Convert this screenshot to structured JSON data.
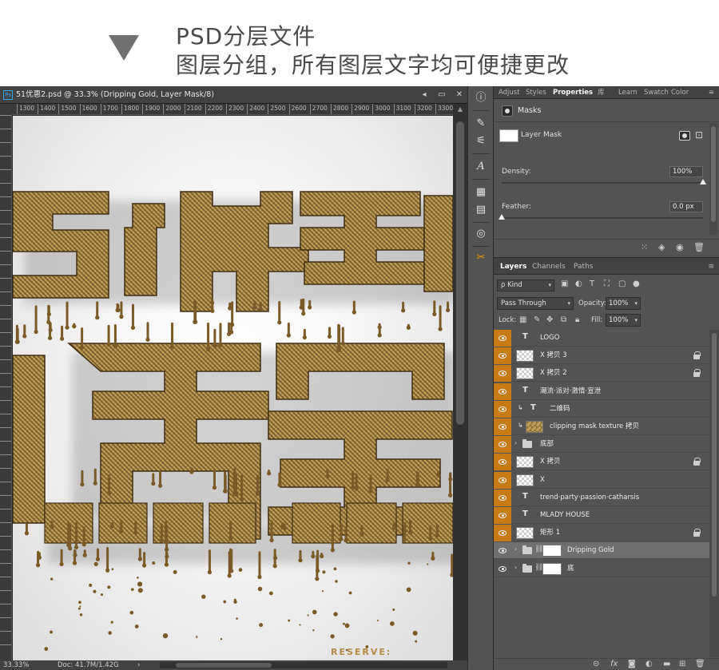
{
  "header": {
    "line1": "PSD分层文件",
    "line2": "图层分组，所有图层文字均可便捷更改"
  },
  "document": {
    "title": "51优惠2.psd @ 33.3% (Dripping Gold, Layer Mask/8)",
    "app_icon": "Ps",
    "window_buttons": [
      "◂",
      "▭",
      "✕"
    ],
    "ruler_ticks": [
      "1300",
      "1400",
      "1500",
      "1600",
      "1700",
      "1800",
      "1900",
      "2000",
      "2100",
      "2200",
      "2300",
      "2400",
      "2500",
      "2600",
      "2700",
      "2800",
      "2900",
      "3000",
      "3100",
      "3200",
      "3300"
    ],
    "reserve_text": "RESERVE:",
    "status": {
      "zoom": "33.33%",
      "doc_size": "Doc: 41.7M/1.42G",
      "more_arrow": "›"
    },
    "artwork_text_color": "#8d6a2e"
  },
  "tools": [
    {
      "name": "info-icon",
      "glyph": "ⓘ"
    },
    {
      "name": "brush-settings-icon",
      "glyph": "✎"
    },
    {
      "name": "adjustments-icon",
      "glyph": "⚟"
    },
    {
      "name": "character-icon",
      "glyph": "A"
    },
    {
      "name": "glyphs-icon",
      "glyph": "▦"
    },
    {
      "name": "notes-icon",
      "glyph": "▤"
    },
    {
      "name": "3d-icon",
      "glyph": "◎"
    },
    {
      "name": "tool-presets-icon",
      "glyph": "✂"
    }
  ],
  "properties": {
    "tabs": [
      "Adjust",
      "Styles",
      "Properties",
      "库",
      "Learn",
      "Swatch",
      "Color"
    ],
    "active_tab": "Properties",
    "menu_icon": "≡",
    "section_title": "Masks",
    "mask_label": "Layer Mask",
    "density": {
      "label": "Density:",
      "value": "100%",
      "fraction": 1.0
    },
    "feather": {
      "label": "Feather:",
      "value": "0.0 px",
      "fraction": 0.0
    }
  },
  "layers_panel": {
    "tabs": [
      "Layers",
      "Channels",
      "Paths"
    ],
    "active_tab": "Layers",
    "menu_icon": "≡",
    "kind_label": "Kind",
    "kind_prefix": "ρ",
    "blend_mode": "Pass Through",
    "opacity_label": "Opacity:",
    "opacity_value": "100%",
    "lock_label": "Lock:",
    "fill_label": "Fill:",
    "fill_value": "100%",
    "footer_icons": [
      "⊝",
      "fx",
      "◙",
      "◐",
      "▬",
      "⊞",
      "🗑"
    ],
    "layers": [
      {
        "name": "LOGO",
        "kind": "text",
        "locked": false,
        "clip": false,
        "orange": true
      },
      {
        "name": "X 拷贝 3",
        "kind": "pixel",
        "locked": true,
        "clip": false,
        "orange": true
      },
      {
        "name": "X 拷贝 2",
        "kind": "pixel",
        "locked": true,
        "clip": false,
        "orange": true
      },
      {
        "name": "潮流·派对·激情·宣泄",
        "kind": "text",
        "locked": false,
        "clip": false,
        "orange": true
      },
      {
        "name": "二维码",
        "kind": "text",
        "locked": false,
        "clip": true,
        "orange": true
      },
      {
        "name": "clipping mask texture 拷贝",
        "kind": "texture",
        "locked": false,
        "clip": true,
        "orange": true
      },
      {
        "name": "底部",
        "kind": "folder",
        "locked": false,
        "clip": false,
        "orange": true
      },
      {
        "name": "X 拷贝",
        "kind": "pixel",
        "locked": true,
        "clip": false,
        "orange": true
      },
      {
        "name": "X",
        "kind": "pixel",
        "locked": false,
        "clip": false,
        "orange": true
      },
      {
        "name": "trend·party·passion·catharsis",
        "kind": "text",
        "locked": false,
        "clip": false,
        "orange": true
      },
      {
        "name": "MLADY HOUSE",
        "kind": "text",
        "locked": false,
        "clip": false,
        "orange": true
      },
      {
        "name": "矩形 1",
        "kind": "pixel",
        "locked": true,
        "clip": false,
        "orange": true
      },
      {
        "name": "Dripping Gold",
        "kind": "folder-mask",
        "locked": false,
        "clip": false,
        "orange": false,
        "selected": true
      },
      {
        "name": "底",
        "kind": "folder-mask",
        "locked": false,
        "clip": false,
        "orange": false
      }
    ]
  },
  "colors": {
    "accent_orange": "#c87a14",
    "gold_light": "#d9b86a",
    "gold_dark": "#5a4320",
    "panel_bg": "#535353"
  }
}
